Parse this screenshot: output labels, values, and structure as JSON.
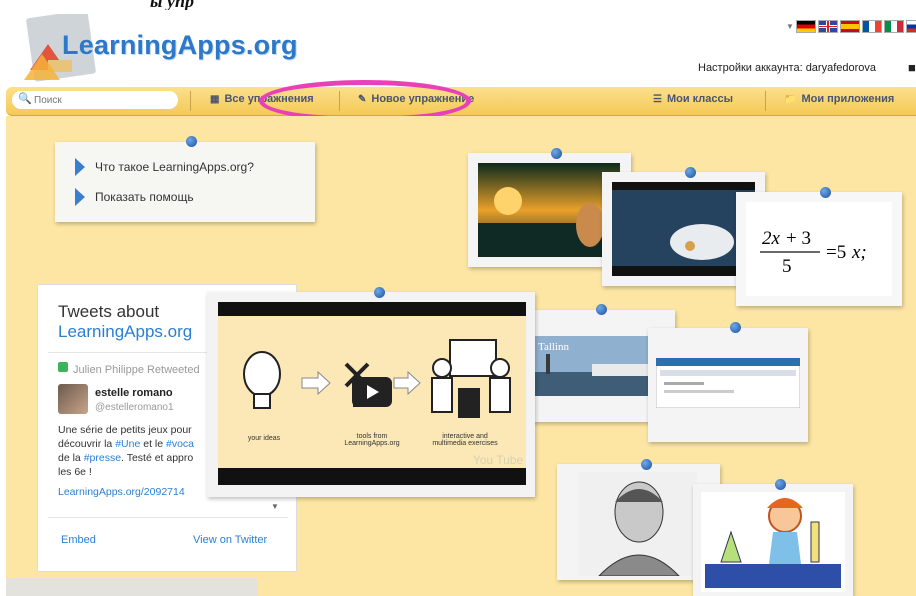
{
  "site": {
    "name": "LearningApps.org"
  },
  "top_fragment": "ы упр",
  "account": {
    "label": "Настройки аккаунта: daryafedorova"
  },
  "languages": [
    "de",
    "en",
    "es",
    "fr",
    "it",
    "ru"
  ],
  "search": {
    "placeholder": "Поиск"
  },
  "nav": {
    "all_exercises": "Все упражнения",
    "new_exercise": "Новое упражнение",
    "my_classes": "Мои классы",
    "my_apps": "Мои приложения"
  },
  "help": {
    "what_is": "Что такое LearningApps.org?",
    "show_help": "Показать помощь"
  },
  "tweets": {
    "title": "Tweets about",
    "subtitle": "LearningApps.org",
    "retweeted": "Julien Philippe Retweeted",
    "author_name": "estelle romano",
    "author_handle": "@estelleromano1",
    "body_1": "Une série de petits jeux pour",
    "body_2_a": "découvrir la ",
    "body_2_h1": "#Une",
    "body_2_b": " et le ",
    "body_2_h2": "#voca",
    "body_3_a": "de la ",
    "body_3_h": "#presse",
    "body_3_b": ". Testé et appro",
    "body_4": "les 6e !",
    "link": "LearningApps.org/2092714",
    "embed": "Embed",
    "view": "View on Twitter"
  },
  "video": {
    "cap1": "your ideas",
    "cap2a": "tools from",
    "cap2b": "LearningApps.org",
    "cap3a": "interactive and",
    "cap3b": "multimedia exercises",
    "watermark": "You Tube"
  },
  "tallinn_label": "Tallinn",
  "equation": "2x + 3 / 5 = 5x",
  "colors": {
    "accent": "#2d78c8",
    "highlight": "#e93fb9",
    "background": "#fde6a3"
  }
}
